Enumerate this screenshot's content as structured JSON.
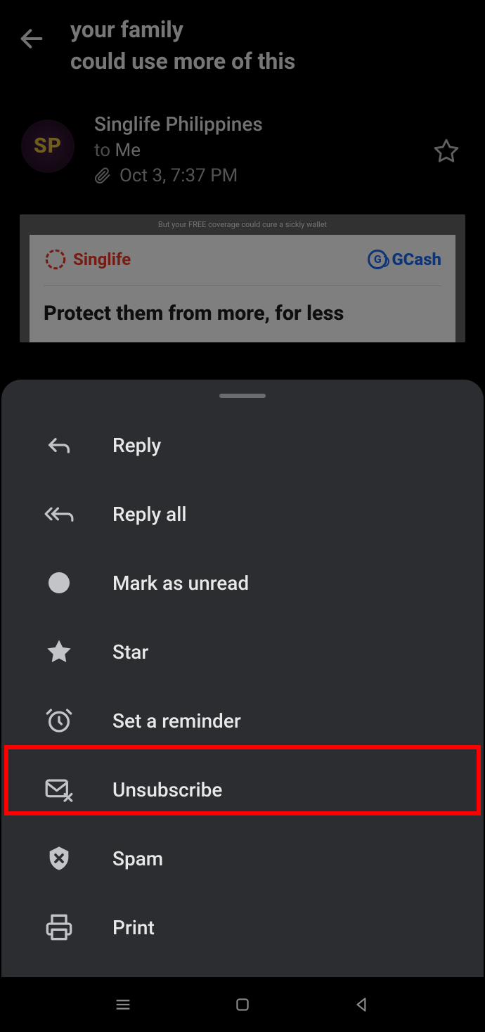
{
  "header": {
    "subject_line1": "your family",
    "subject_line2": "could use more of this"
  },
  "sender": {
    "avatar_initials": "SP",
    "name": "Singlife Philippines",
    "to_prefix": "to",
    "to_name": "Me",
    "date": "Oct 3, 7:37 PM"
  },
  "email": {
    "preview_caption": "But your FREE coverage could cure a sickly wallet",
    "brand_left": "Singlife",
    "brand_right": "GCash",
    "headline": "Protect them from more, for less"
  },
  "menu": {
    "reply": "Reply",
    "reply_all": "Reply all",
    "mark_unread": "Mark as unread",
    "star": "Star",
    "reminder": "Set a reminder",
    "unsubscribe": "Unsubscribe",
    "spam": "Spam",
    "print": "Print"
  }
}
